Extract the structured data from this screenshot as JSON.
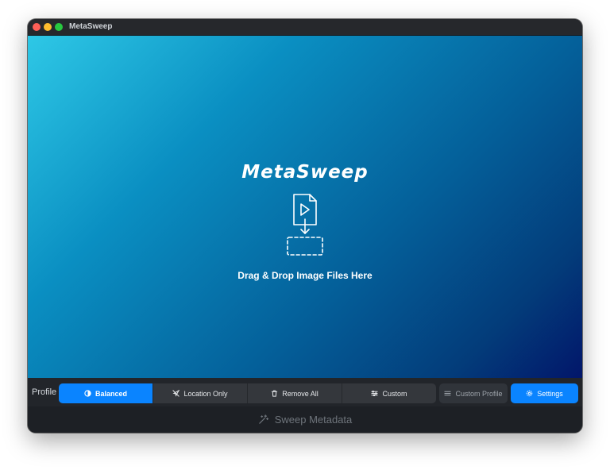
{
  "window": {
    "title": "MetaSweep"
  },
  "dropzone": {
    "logo": "MetaSweep",
    "hint": "Drag & Drop Image Files Here",
    "icon": "file-drop-icon"
  },
  "toolbar": {
    "profile_label": "Profile",
    "segments": [
      {
        "label": "Balanced",
        "icon": "half-circle-icon",
        "selected": true
      },
      {
        "label": "Location Only",
        "icon": "location-slash-icon",
        "selected": false
      },
      {
        "label": "Remove All",
        "icon": "trash-icon",
        "selected": false
      },
      {
        "label": "Custom",
        "icon": "sliders-icon",
        "selected": false
      }
    ],
    "custom_profile_label": "Custom Profile",
    "settings_label": "Settings"
  },
  "footer": {
    "sweep_label": "Sweep Metadata",
    "icon": "magic-wand-icon"
  },
  "colors": {
    "accent": "#0a84ff",
    "gradient_start": "#2ec8e6",
    "gradient_end": "#02166a"
  }
}
